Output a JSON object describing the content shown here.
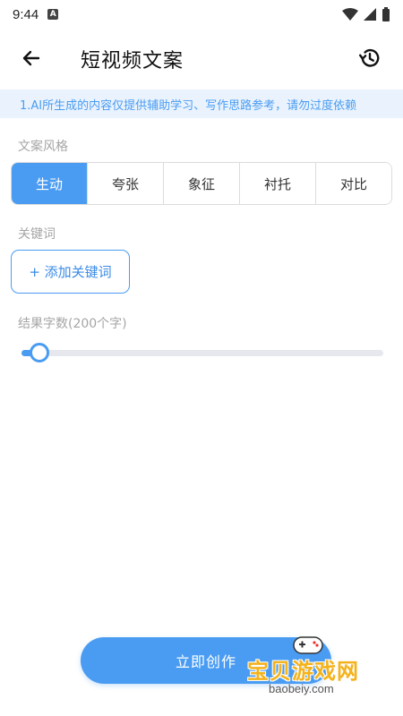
{
  "status_bar": {
    "time": "9:44"
  },
  "header": {
    "title": "短视频文案"
  },
  "notice": {
    "text": "1.AI所生成的内容仅提供辅助学习、写作思路参考，请勿过度依赖"
  },
  "style_section": {
    "label": "文案风格",
    "options": [
      "生动",
      "夸张",
      "象征",
      "衬托",
      "对比"
    ],
    "selected": "生动"
  },
  "keywords_section": {
    "label": "关键词",
    "add_button": "+ 添加关键词"
  },
  "length_section": {
    "label": "结果字数(200个字)",
    "slider_value_fraction": 0.05
  },
  "footer": {
    "create_button": "立即创作"
  },
  "watermark": {
    "text": "宝贝游戏网",
    "url": "baobeiy.com"
  },
  "colors": {
    "accent": "#4a9cf2",
    "notice_bg": "#eaf3fd"
  }
}
